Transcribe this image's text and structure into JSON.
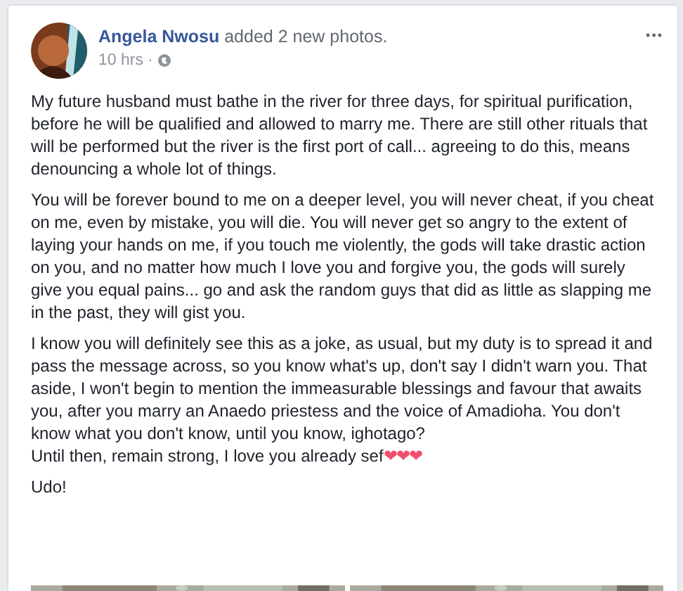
{
  "post": {
    "author": "Angela Nwosu",
    "action": "added 2 new photos.",
    "time": "10 hrs",
    "separator": "·",
    "more": "•••",
    "paragraphs": [
      {
        "text": "My future husband must bathe in the river for three days, for spiritual purification, before he will be qualified and allowed to marry me. There are still other rituals that will be performed but the river is the first port of call... agreeing to do this, means denouncing a whole lot of things."
      },
      {
        "text": "You will be forever bound to me on a deeper level, you will never cheat, if you cheat on me, even by mistake, you will die. You will never get so angry to the extent of laying your hands on me, if you touch me violently, the gods will take drastic action on you, and no matter how much I love you and forgive you, the gods will surely give you equal pains... go and ask the random guys that did as little as slapping me in the past, they will gist you."
      },
      {
        "text": "I know you will definitely see this as a joke, as usual, but my duty is to spread it and pass the message across, so you know what's up, don't say I didn't warn you. That aside, I won't begin to mention the immeasurable blessings and favour that awaits you, after you marry an Anaedo priestess and the voice of Amadioha. You don't know what you don't know, until you know, ighotago?",
        "after": "Until then, remain strong, I love you already sef",
        "emoji": "❤❤❤"
      },
      {
        "text": "Udo!"
      }
    ]
  }
}
